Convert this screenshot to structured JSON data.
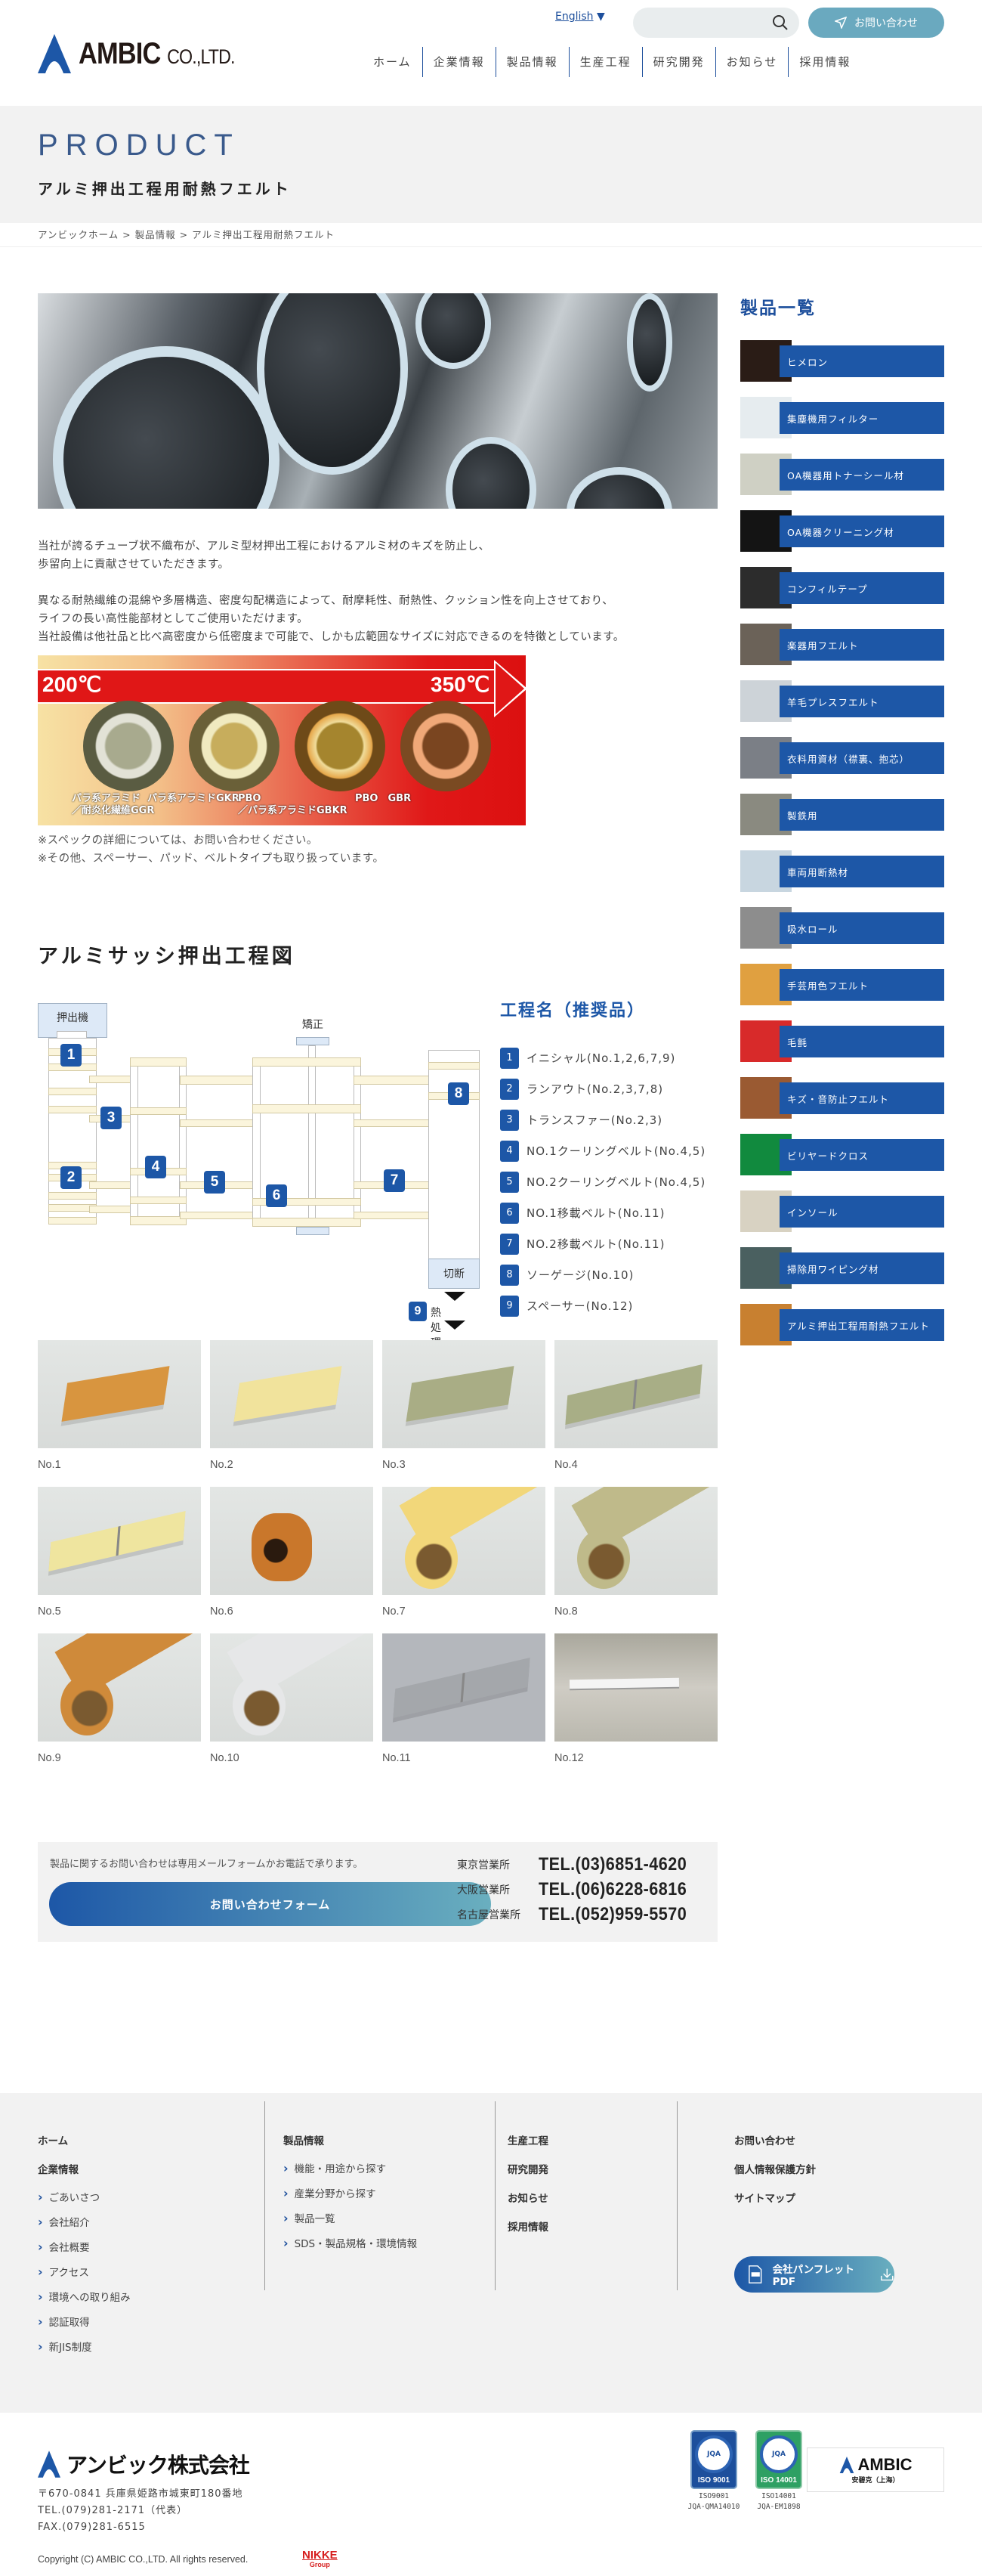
{
  "header": {
    "logo_text": "AMBIC",
    "logo_suffix": "CO.,LTD.",
    "language": "English",
    "language_arrow": "▼",
    "search_placeholder": "",
    "contact_label": "お問い合わせ",
    "nav": [
      "ホーム",
      "企業情報",
      "製品情報",
      "生産工程",
      "研究開発",
      "お知らせ",
      "採用情報"
    ]
  },
  "hero": {
    "title_en": "PRODUCT",
    "title_jp": "アルミ押出工程用耐熱フエルト"
  },
  "breadcrumb": [
    "アンビックホーム",
    "製品情報",
    "アルミ押出工程用耐熱フエルト"
  ],
  "breadcrumb_sep": ">",
  "main": {
    "intro": [
      [
        "当社が誇るチューブ状不織布が、アルミ型材押出工程におけるアルミ材のキズを防止し、",
        "歩留向上に貢献させていただきます。"
      ],
      [
        "異なる耐熱繊維の混綿や多層構造、密度勾配構造によって、耐摩耗性、耐熱性、クッション性を向上させており、",
        "ライフの長い高性能部材としてご使用いただけます。",
        "当社設備は他社品と比べ高密度から低密度まで可能で、しかも広範囲なサイズに対応できるのを特徴としています。"
      ]
    ],
    "temperature_chart": {
      "low": "200℃",
      "high": "350℃",
      "materials": [
        {
          "line1": "パラ系アラミド",
          "line2": "／耐炎化繊維GGR"
        },
        {
          "line1": "パラ系アラミドGKR",
          "line2": ""
        },
        {
          "line1": "PBO",
          "line2": "／パラ系アラミドGBKR"
        },
        {
          "line1": "PBO　GBR",
          "line2": ""
        }
      ]
    },
    "notes": [
      "※スペックの詳細については、お問い合わせください。",
      "※その他、スペーサー、パッド、ベルトタイプも取り扱っています。"
    ],
    "diagram_title": "アルミサッシ押出工程図",
    "diagram": {
      "extruder": "押出機",
      "straightening": "矯正",
      "cutting": "切断",
      "heat_treatment": "熱処理",
      "numbers": [
        "1",
        "2",
        "3",
        "4",
        "5",
        "6",
        "7",
        "8",
        "9"
      ]
    },
    "steps_title": "工程名（推奨品）",
    "steps": [
      {
        "n": "1",
        "label": "イニシャル(No.1,2,6,7,9)"
      },
      {
        "n": "2",
        "label": "ランアウト(No.2,3,7,8)"
      },
      {
        "n": "3",
        "label": "トランスファー(No.2,3)"
      },
      {
        "n": "4",
        "label": "NO.1クーリングベルト(No.4,5)"
      },
      {
        "n": "5",
        "label": "NO.2クーリングベルト(No.4,5)"
      },
      {
        "n": "6",
        "label": "NO.1移載ベルト(No.11)"
      },
      {
        "n": "7",
        "label": "NO.2移載ベルト(No.11)"
      },
      {
        "n": "8",
        "label": "ソーゲージ(No.10)"
      },
      {
        "n": "9",
        "label": "スペーサー(No.12)"
      }
    ],
    "gallery": [
      {
        "label": "No.1",
        "shape": "block",
        "color": "#d8953f"
      },
      {
        "label": "No.2",
        "shape": "block",
        "color": "#f1e39c"
      },
      {
        "label": "No.3",
        "shape": "block",
        "color": "#a9ad85"
      },
      {
        "label": "No.4",
        "shape": "block-joint",
        "color": "#a8ae86"
      },
      {
        "label": "No.5",
        "shape": "block-joint",
        "color": "#efe59f"
      },
      {
        "label": "No.6",
        "shape": "ring",
        "color": "#c9772b"
      },
      {
        "label": "No.7",
        "shape": "tube",
        "color": "#f2d77a"
      },
      {
        "label": "No.8",
        "shape": "tube",
        "color": "#bfba8a"
      },
      {
        "label": "No.9",
        "shape": "tube",
        "color": "#cf8a3a"
      },
      {
        "label": "No.10",
        "shape": "tube",
        "color": "#e6e7e8"
      },
      {
        "label": "No.11",
        "shape": "block-joint",
        "color": "#a4a7ab"
      },
      {
        "label": "No.12",
        "shape": "strip",
        "color": "#f4f4f4"
      }
    ]
  },
  "contact": {
    "message": "製品に関するお問い合わせは専用メールフォームかお電話で承ります。",
    "form_button": "お問い合わせフォーム",
    "offices": [
      {
        "office": "東京営業所",
        "tel": "TEL.(03)6851-4620"
      },
      {
        "office": "大阪営業所",
        "tel": "TEL.(06)6228-6816"
      },
      {
        "office": "名古屋営業所",
        "tel": "TEL.(052)959-5570"
      }
    ]
  },
  "sidebar": {
    "title": "製品一覧",
    "items": [
      {
        "label": "ヒメロン",
        "thumb": "#2a1c16"
      },
      {
        "label": "集塵機用フィルター",
        "thumb": "#e6ecef"
      },
      {
        "label": "OA機器用トナーシール材",
        "thumb": "#cfd0c4"
      },
      {
        "label": "OA機器クリーニング材",
        "thumb": "#141414"
      },
      {
        "label": "コンフィルテープ",
        "thumb": "#2c2c2c"
      },
      {
        "label": "楽器用フエルト",
        "thumb": "#6b6258"
      },
      {
        "label": "羊毛プレスフエルト",
        "thumb": "#cdd3d8"
      },
      {
        "label": "衣料用資材（襟裏、抱芯）",
        "thumb": "#7b7f86"
      },
      {
        "label": "製鉄用",
        "thumb": "#8a8a80"
      },
      {
        "label": "車両用断熱材",
        "thumb": "#c8d6e0"
      },
      {
        "label": "吸水ロール",
        "thumb": "#8d8d8d"
      },
      {
        "label": "手芸用色フエルト",
        "thumb": "#e0a040"
      },
      {
        "label": "毛氈",
        "thumb": "#d82a2a"
      },
      {
        "label": "キズ・音防止フエルト",
        "thumb": "#9a5a32"
      },
      {
        "label": "ビリヤードクロス",
        "thumb": "#118a3e"
      },
      {
        "label": "インソール",
        "thumb": "#d8d2c2"
      },
      {
        "label": "掃除用ワイピング材",
        "thumb": "#4a6060"
      },
      {
        "label": "アルミ押出工程用耐熱フエルト",
        "thumb": "#c88030"
      }
    ]
  },
  "footer": {
    "col1": {
      "heads": [
        "ホーム",
        "企業情報"
      ],
      "subs": [
        "ごあいさつ",
        "会社紹介",
        "会社概要",
        "アクセス",
        "環境への取り組み",
        "認証取得",
        "新JIS制度"
      ]
    },
    "col2": {
      "head": "製品情報",
      "subs": [
        "機能・用途から探す",
        "産業分野から探す",
        "製品一覧",
        "SDS・製品規格・環境情報"
      ]
    },
    "col3": {
      "heads": [
        "生産工程",
        "研究開発",
        "お知らせ",
        "採用情報"
      ]
    },
    "col4": {
      "heads": [
        "お問い合わせ",
        "個人情報保護方針",
        "サイトマップ"
      ],
      "pdf_button": "会社パンフレットPDF",
      "pdf_icon_text": "PDF"
    },
    "company_name": "アンビック株式会社",
    "address": [
      "〒670-0841 兵庫県姫路市城東町180番地",
      "TEL.(079)281-2171（代表）",
      "FAX.(079)281-6515"
    ],
    "copyright": "Copyright (C) AMBIC CO.,LTD. All rights reserved.",
    "nikke": "NIKKE",
    "nikke_sub": "Group",
    "certs": [
      {
        "badge": "ISO 9001",
        "caption1": "ISO9001",
        "caption2": "JQA-QMA14010",
        "color": "#1d4f9c"
      },
      {
        "badge": "ISO 14001",
        "caption1": "ISO14001",
        "caption2": "JQA-EM1898",
        "color": "#2ea063"
      }
    ],
    "jqa_text": "JQA",
    "shanghai_logo": "AMBIC",
    "shanghai_sub": "安碧克（上海）"
  }
}
